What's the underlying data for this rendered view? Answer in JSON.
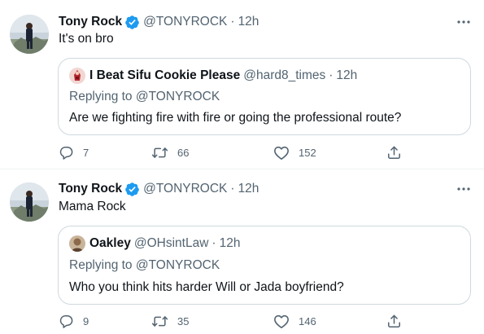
{
  "tweets": [
    {
      "author_name": "Tony Rock",
      "author_handle": "@TONYROCK",
      "dot": "·",
      "time": "12h",
      "text": "It's on bro",
      "quote": {
        "author_name": "I Beat Sifu Cookie Please",
        "author_handle": "@hard8_times",
        "dot": "·",
        "time": "12h",
        "replying_prefix": "Replying to ",
        "replying_to": "@TONYROCK",
        "text": "Are we fighting fire with fire or going the professional route?"
      },
      "actions": {
        "replies": "7",
        "retweets": "66",
        "likes": "152"
      }
    },
    {
      "author_name": "Tony Rock",
      "author_handle": "@TONYROCK",
      "dot": "·",
      "time": "12h",
      "text": "Mama Rock",
      "quote": {
        "author_name": "Oakley",
        "author_handle": "@OHsintLaw",
        "dot": "·",
        "time": "12h",
        "replying_prefix": "Replying to ",
        "replying_to": "@TONYROCK",
        "text": "Who you think hits harder Will or Jada boyfriend?"
      },
      "actions": {
        "replies": "9",
        "retweets": "35",
        "likes": "146"
      }
    }
  ],
  "icons": {
    "verified": "verified-badge-icon",
    "more": "more-dots-icon",
    "reply": "reply-bubble-icon",
    "retweet": "retweet-icon",
    "like": "heart-icon",
    "share": "share-icon"
  },
  "colors": {
    "verified": "#1d9bf0",
    "text_primary": "#0f1419",
    "text_secondary": "#536471",
    "border": "#cfd9de",
    "divider": "#eff3f4"
  }
}
